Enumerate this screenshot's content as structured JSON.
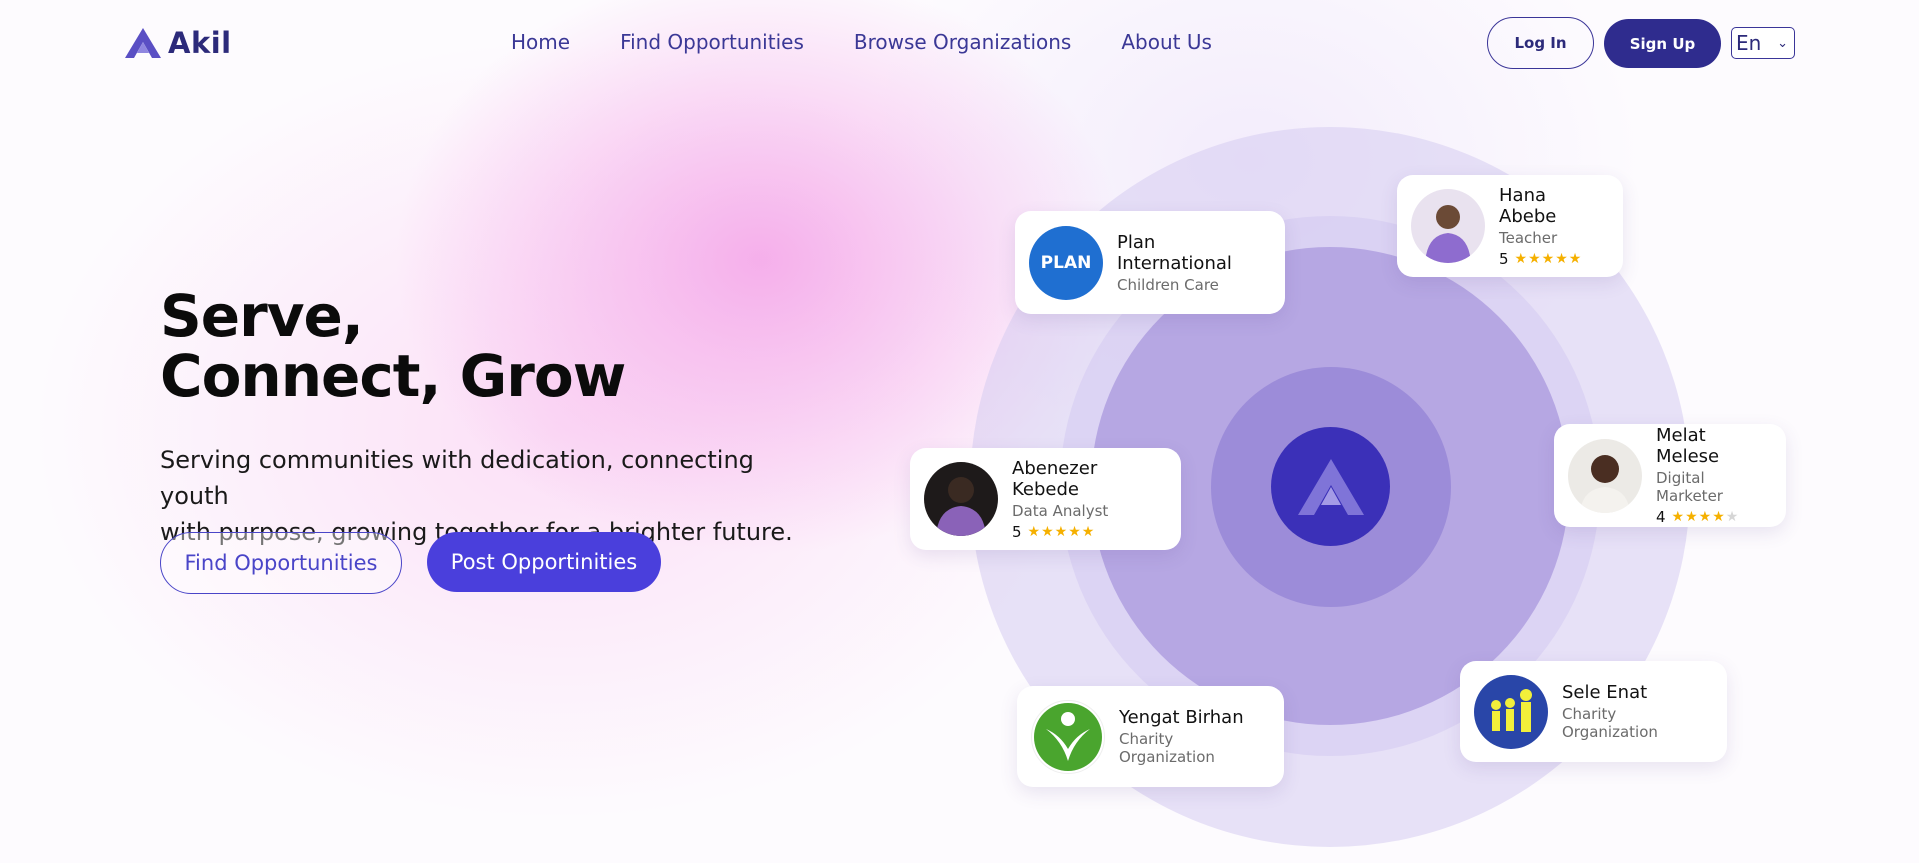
{
  "header": {
    "logo_text": "Akil",
    "nav": [
      {
        "label": "Home"
      },
      {
        "label": "Find Opportunities"
      },
      {
        "label": "Browse Organizations"
      },
      {
        "label": "About Us"
      }
    ],
    "login_label": "Log In",
    "signup_label": "Sign Up",
    "language": "En"
  },
  "hero": {
    "title_line1": "Serve,",
    "title_line2": "Connect, Grow",
    "subtitle_line1": "Serving communities with dedication, connecting youth",
    "subtitle_line2": "with purpose, growing together for a brighter future.",
    "find_button": "Find Opportunities",
    "post_button": "Post Opportinities"
  },
  "cards": {
    "plan": {
      "name": "Plan International",
      "role": "Children Care",
      "logo_text": "PLAN"
    },
    "hana": {
      "name": "Hana Abebe",
      "role": "Teacher",
      "rating": "5"
    },
    "abenezer": {
      "name": "Abenezer Kebede",
      "role": "Data Analyst",
      "rating": "5"
    },
    "melat": {
      "name": "Melat Melese",
      "role": "Digital Marketer",
      "rating": "4"
    },
    "yengat": {
      "name": "Yengat Birhan",
      "role": "Charity Organization"
    },
    "sele": {
      "name": "Sele Enat",
      "role": "Charity Organization"
    }
  },
  "colors": {
    "brand_dark": "#2f2c8e",
    "brand_primary": "#4a3fdc",
    "star": "#f5b000"
  }
}
